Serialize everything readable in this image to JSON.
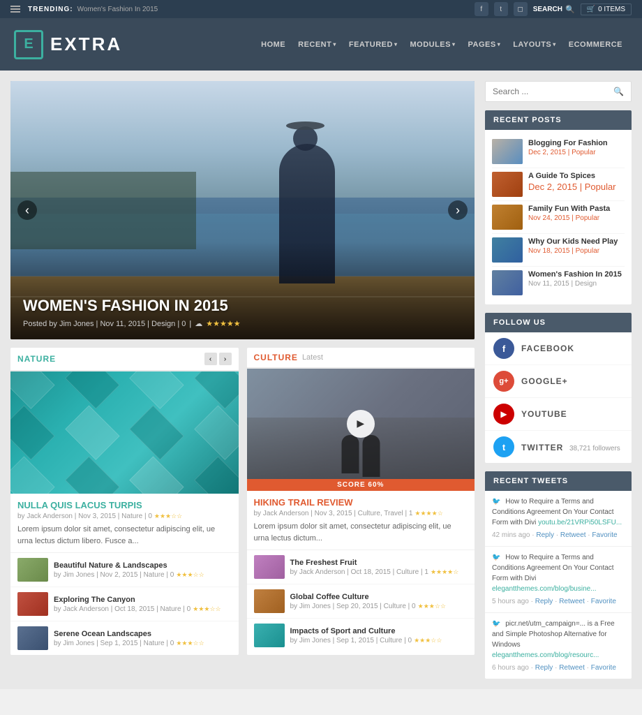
{
  "topbar": {
    "trending_label": "TRENDING:",
    "trending_text": "Women's Fashion In 2015",
    "search_label": "SEARCH",
    "cart_label": "0 ITEMS"
  },
  "header": {
    "logo_letter": "E",
    "logo_name": "EXTRA",
    "nav": [
      "HOME",
      "RECENT",
      "FEATURED",
      "MODULES",
      "PAGES",
      "LAYOUTS",
      "ECOMMERCE"
    ]
  },
  "hero": {
    "title": "WOMEN'S FASHION IN 2015",
    "meta": "Posted by Jim Jones | Nov 11, 2015 | Design | 0",
    "left_arrow": "‹",
    "right_arrow": "›"
  },
  "nature": {
    "section_label": "NATURE",
    "article_title": "NULLA QUIS LACUS TURPIS",
    "article_meta": "by Jack Anderson | Nov 3, 2015 | Nature | 0",
    "article_excerpt": "Lorem ipsum dolor sit amet, consectetur adipiscing elit, ue urna lectus dictum libero. Fusce a...",
    "sub_articles": [
      {
        "title": "Beautiful Nature & Landscapes",
        "meta": "by Jim Jones | Nov 2, 2015 | Nature | 0",
        "thumb": "green"
      },
      {
        "title": "Exploring The Canyon",
        "meta": "by Jack Anderson | Oct 18, 2015 | Nature | 0",
        "thumb": "red"
      },
      {
        "title": "Serene Ocean Landscapes",
        "meta": "by Jim Jones | Sep 1, 2015 | Nature | 0",
        "thumb": "blue"
      }
    ]
  },
  "culture": {
    "section_label": "CULTURE",
    "section_sub": "Latest",
    "score_label": "SCORE 60%",
    "article_title": "HIKING TRAIL REVIEW",
    "article_meta": "by Jack Anderson | Nov 3, 2015 | Culture, Travel | 1",
    "article_excerpt": "Lorem ipsum dolor sit amet, consectetur adipiscing elit, ue urna lectus dictum...",
    "sub_articles": [
      {
        "title": "The Freshest Fruit",
        "meta": "by Jack Anderson | Oct 18, 2015 | Culture | 1",
        "thumb": "purple"
      },
      {
        "title": "Global Coffee Culture",
        "meta": "by Jim Jones | Sep 20, 2015 | Culture | 0",
        "thumb": "orange"
      },
      {
        "title": "Impacts of Sport and Culture",
        "meta": "by Jim Jones | Sep 1, 2015 | Culture | 0",
        "thumb": "teal"
      }
    ]
  },
  "sidebar": {
    "search_placeholder": "Search ...",
    "recent_posts": {
      "header": "RECENT POSTS",
      "items": [
        {
          "title": "Blogging For Fashion",
          "meta": "Dec 2, 2015 | Popular",
          "thumb": "t1"
        },
        {
          "title": "A Guide To Spices",
          "meta": "Dec 2, 2015 | Popular",
          "thumb": "t2"
        },
        {
          "title": "Family Fun With Pasta",
          "meta": "Nov 24, 2015 | Popular",
          "thumb": "t3"
        },
        {
          "title": "Why Our Kids Need Play",
          "meta": "Nov 18, 2015 | Popular",
          "thumb": "t4"
        },
        {
          "title": "Women's Fashion In 2015",
          "meta": "Nov 11, 2015 | Design",
          "thumb": "t5"
        }
      ]
    },
    "follow_us": {
      "header": "FOLLOW US",
      "items": [
        {
          "name": "FACEBOOK",
          "icon": "f",
          "class": "fi-fb",
          "count": ""
        },
        {
          "name": "GOOGLE+",
          "icon": "g+",
          "class": "fi-gp",
          "count": ""
        },
        {
          "name": "YOUTUBE",
          "icon": "▶",
          "class": "fi-yt",
          "count": ""
        },
        {
          "name": "TWITTER",
          "icon": "t",
          "class": "fi-tw",
          "count": "38,721 followers"
        }
      ]
    },
    "recent_tweets": {
      "header": "RECENT TWEETS",
      "items": [
        {
          "text": "How to Require a Terms and Conditions Agreement On Your Contact Form with Divi",
          "link": "youtu.be/21VRPi50LSFU...",
          "time": "42 mins ago",
          "actions": [
            "Reply",
            "Retweet",
            "Favorite"
          ]
        },
        {
          "text": "How to Require a Terms and Conditions Agreement On Your Contact Form with Divi",
          "link": "elegantthemes.com/blog/busine...",
          "time": "5 hours ago",
          "actions": [
            "Reply",
            "Retweet",
            "Favorite"
          ]
        },
        {
          "text": "picr.net/utm_campaign=... is a Free and Simple Photoshop Alternative for Windows",
          "link": "elegantthemes.com/blog/resourc...",
          "time": "6 hours ago",
          "actions": [
            "Reply",
            "Retweet",
            "Favorite"
          ]
        }
      ]
    }
  },
  "icons": {
    "hamburger": "☰",
    "facebook": "f",
    "twitter": "t",
    "instagram": "◻",
    "search": "🔍",
    "cart": "🛒",
    "play": "▶",
    "star_filled": "★",
    "star_empty": "☆",
    "cloud": "☁",
    "chevron_left": "‹",
    "chevron_right": "›"
  }
}
